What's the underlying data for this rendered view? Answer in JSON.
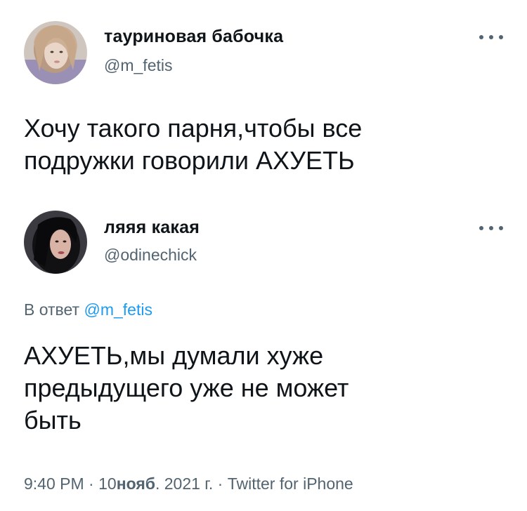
{
  "tweet1": {
    "author_name": "тауриновая бабочка",
    "handle": "@m_fetis",
    "text_line1": "Хочу такого парня,чтобы все",
    "text_line2": "подружки говорили АХУЕТЬ"
  },
  "tweet2": {
    "author_name": "ляяя какая",
    "handle": "@odinechick",
    "reply_prefix": "В ответ",
    "reply_mention": "@m_fetis",
    "text_line1": "АХУЕТЬ,мы думали хуже",
    "text_line2": "предыдущего уже не может",
    "text_line3": "быть"
  },
  "meta": {
    "time": "9:40 PM",
    "sep1": "·",
    "day": "10",
    "month": "нояб",
    "year_rest": ". 2021 г.",
    "sep2": "·",
    "source": "Twitter for iPhone"
  },
  "colors": {
    "text": "#0f1419",
    "secondary": "#536471",
    "link": "#1d9bf0"
  },
  "icons": [
    "more-options-icon"
  ]
}
